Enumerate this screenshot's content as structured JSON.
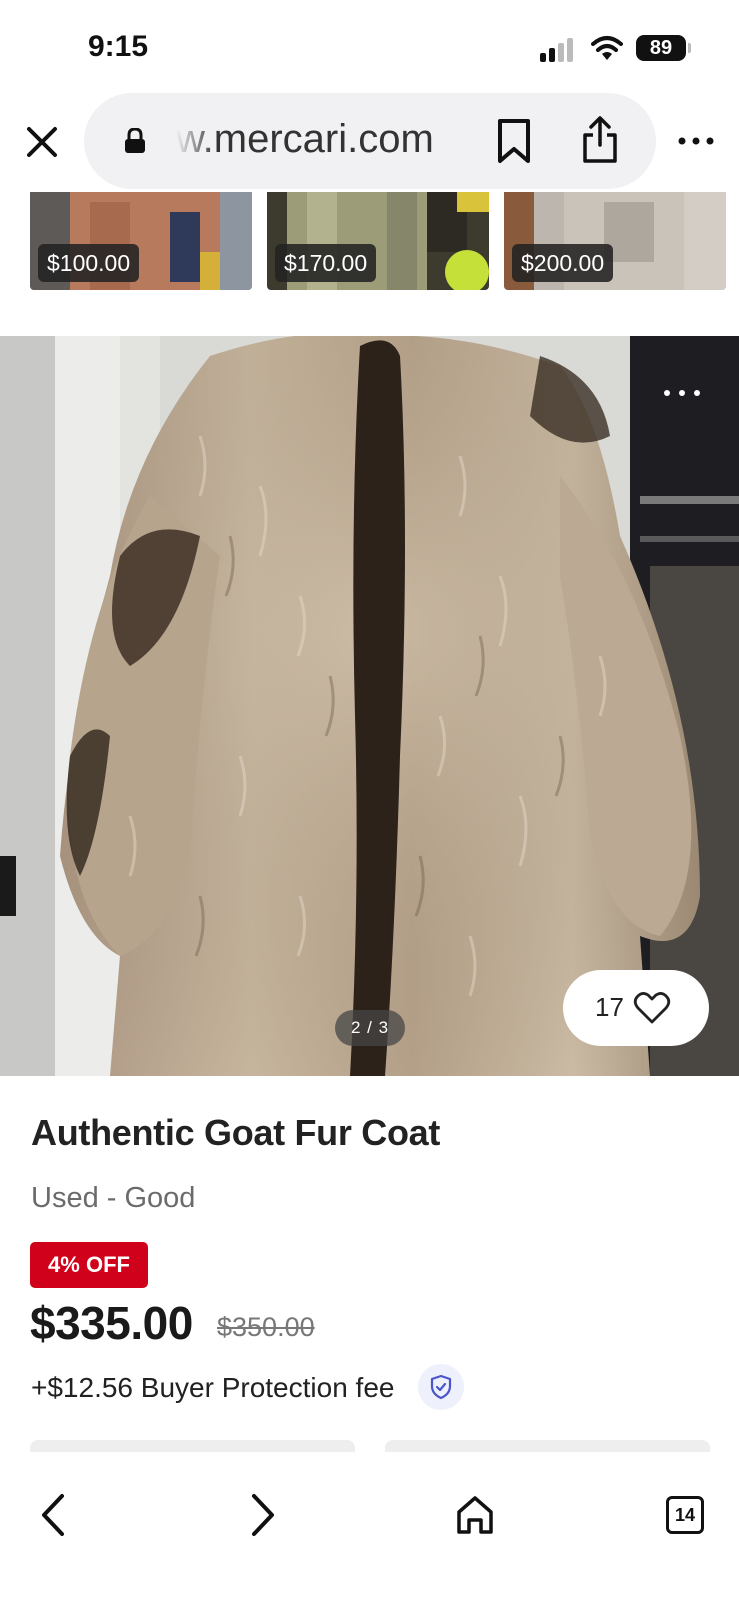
{
  "status_bar": {
    "time": "9:15",
    "battery": "89"
  },
  "browser": {
    "url": "w.mercari.com"
  },
  "similar_items": [
    {
      "price": "$100.00"
    },
    {
      "price": "$170.00"
    },
    {
      "price": "$200.00"
    }
  ],
  "gallery": {
    "indicator": "2 / 3",
    "likes": "17"
  },
  "item": {
    "title": "Authentic Goat Fur Coat",
    "condition": "Used - Good",
    "discount_badge": "4% OFF",
    "price": "$335.00",
    "original_price": "$350.00",
    "fee": "+$12.56 Buyer Protection fee"
  },
  "toolbar": {
    "tabs_count": "14"
  },
  "colors": {
    "accent_red": "#d0021b",
    "shield_blue": "#4a56c9"
  }
}
